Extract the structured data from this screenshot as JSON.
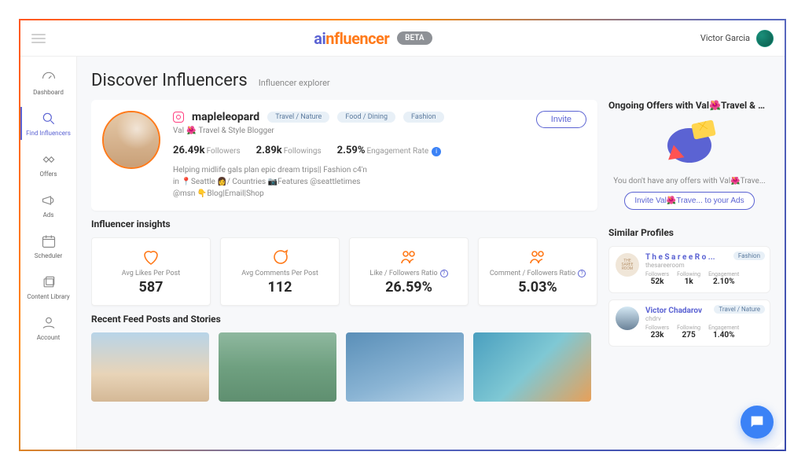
{
  "header": {
    "brand_ai": "ai",
    "brand_inf": "nfluencer",
    "beta_label": "BETA",
    "user_name": "Victor Garcia"
  },
  "sidebar": {
    "items": [
      {
        "label": "Dashboard"
      },
      {
        "label": "Find Influencers"
      },
      {
        "label": "Offers"
      },
      {
        "label": "Ads"
      },
      {
        "label": "Scheduler"
      },
      {
        "label": "Content Library"
      },
      {
        "label": "Account"
      }
    ]
  },
  "page": {
    "title": "Discover Influencers",
    "subtitle": "Influencer explorer"
  },
  "profile": {
    "handle": "mapleleopard",
    "tags": [
      "Travel / Nature",
      "Food / Dining",
      "Fashion"
    ],
    "tagline_prefix": "Val",
    "tagline_suffix": "Travel & Style Blogger",
    "invite_label": "Invite",
    "followers_val": "26.49k",
    "followers_lbl": "Followers",
    "followings_val": "2.89k",
    "followings_lbl": "Followings",
    "engagement_val": "2.59%",
    "engagement_lbl": "Engagement Rate",
    "bio_line1": "Helping midlife gals plan epic dream trips|| Fashion c4'n",
    "bio_line2_a": "in ",
    "bio_line2_b": "Seattle ",
    "bio_line2_c": "/ Countries ",
    "bio_line2_d": "Features @seattletimes",
    "bio_line3": "@msn 👇Blog|Email|Shop"
  },
  "insights": {
    "title": "Influencer insights",
    "boxes": [
      {
        "label": "Avg Likes Per Post",
        "value": "587"
      },
      {
        "label": "Avg Comments Per Post",
        "value": "112"
      },
      {
        "label": "Like / Followers Ratio",
        "value": "26.59%"
      },
      {
        "label": "Comment / Followers Ratio",
        "value": "5.03%"
      }
    ]
  },
  "feed": {
    "title": "Recent Feed Posts and Stories"
  },
  "ongoing": {
    "title": "Ongoing Offers with Val🌺Travel & Sty...",
    "empty": "You don't have any offers with Val🌺Trave...",
    "invite_btn": "Invite Val🌺Trave... to your Ads"
  },
  "similar": {
    "title": "Similar Profiles",
    "profiles": [
      {
        "name": "T h e S a r e e R o ...",
        "handle": "thesareeroom",
        "tag": "Fashion",
        "followers": "52k",
        "followers_lbl": "Followers",
        "following": "1k",
        "following_lbl": "Following",
        "engagement": "2.10%",
        "engagement_lbl": "Engagement"
      },
      {
        "name": "Victor Chadarov",
        "handle": "chdrv",
        "tag": "Travel / Nature",
        "followers": "23k",
        "followers_lbl": "Followers",
        "following": "275",
        "following_lbl": "Following",
        "engagement": "1.40%",
        "engagement_lbl": "Engagement"
      }
    ]
  }
}
